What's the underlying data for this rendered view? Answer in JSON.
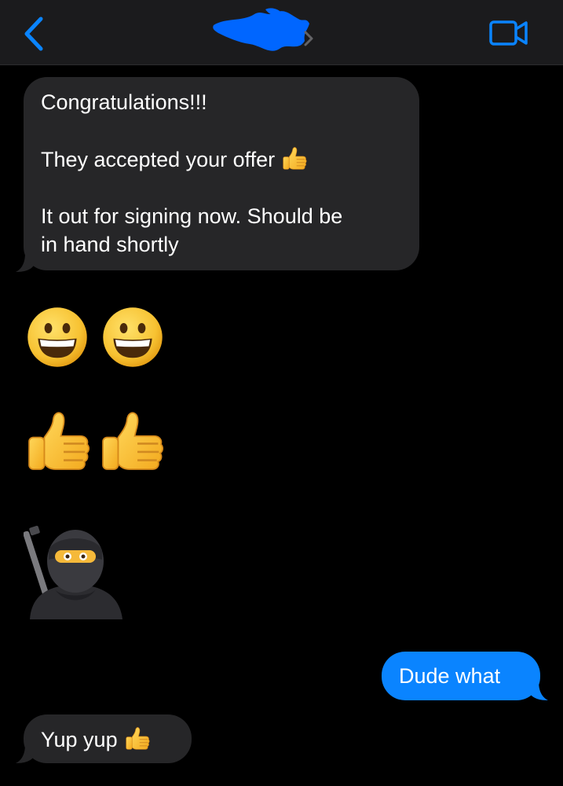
{
  "header": {
    "back_icon": "chevron-left-icon",
    "contact_name_hidden": true,
    "contact_chevron_icon": "chevron-right-icon",
    "video_icon": "video-camera-icon"
  },
  "messages": [
    {
      "direction": "incoming",
      "lines": [
        "Congratulations!!!",
        "",
        "They accepted your offer",
        "",
        "It out for signing now.  Should be",
        "in hand shortly"
      ],
      "inline_emoji": "thumbs-up"
    },
    {
      "direction": "incoming",
      "big_emoji": [
        "grinning-face",
        "grinning-face"
      ]
    },
    {
      "direction": "incoming",
      "big_emoji": [
        "thumbs-up",
        "thumbs-up"
      ]
    },
    {
      "direction": "incoming",
      "big_emoji": [
        "ninja"
      ]
    },
    {
      "direction": "outgoing",
      "text": "Dude what"
    },
    {
      "direction": "incoming",
      "text": "Yup yup",
      "inline_emoji": "thumbs-up"
    }
  ],
  "colors": {
    "background": "#000000",
    "nav_background": "#1b1b1d",
    "incoming_bubble": "#262628",
    "outgoing_bubble": "#0a84ff",
    "accent": "#0a84ff",
    "redaction": "#0066ff"
  }
}
